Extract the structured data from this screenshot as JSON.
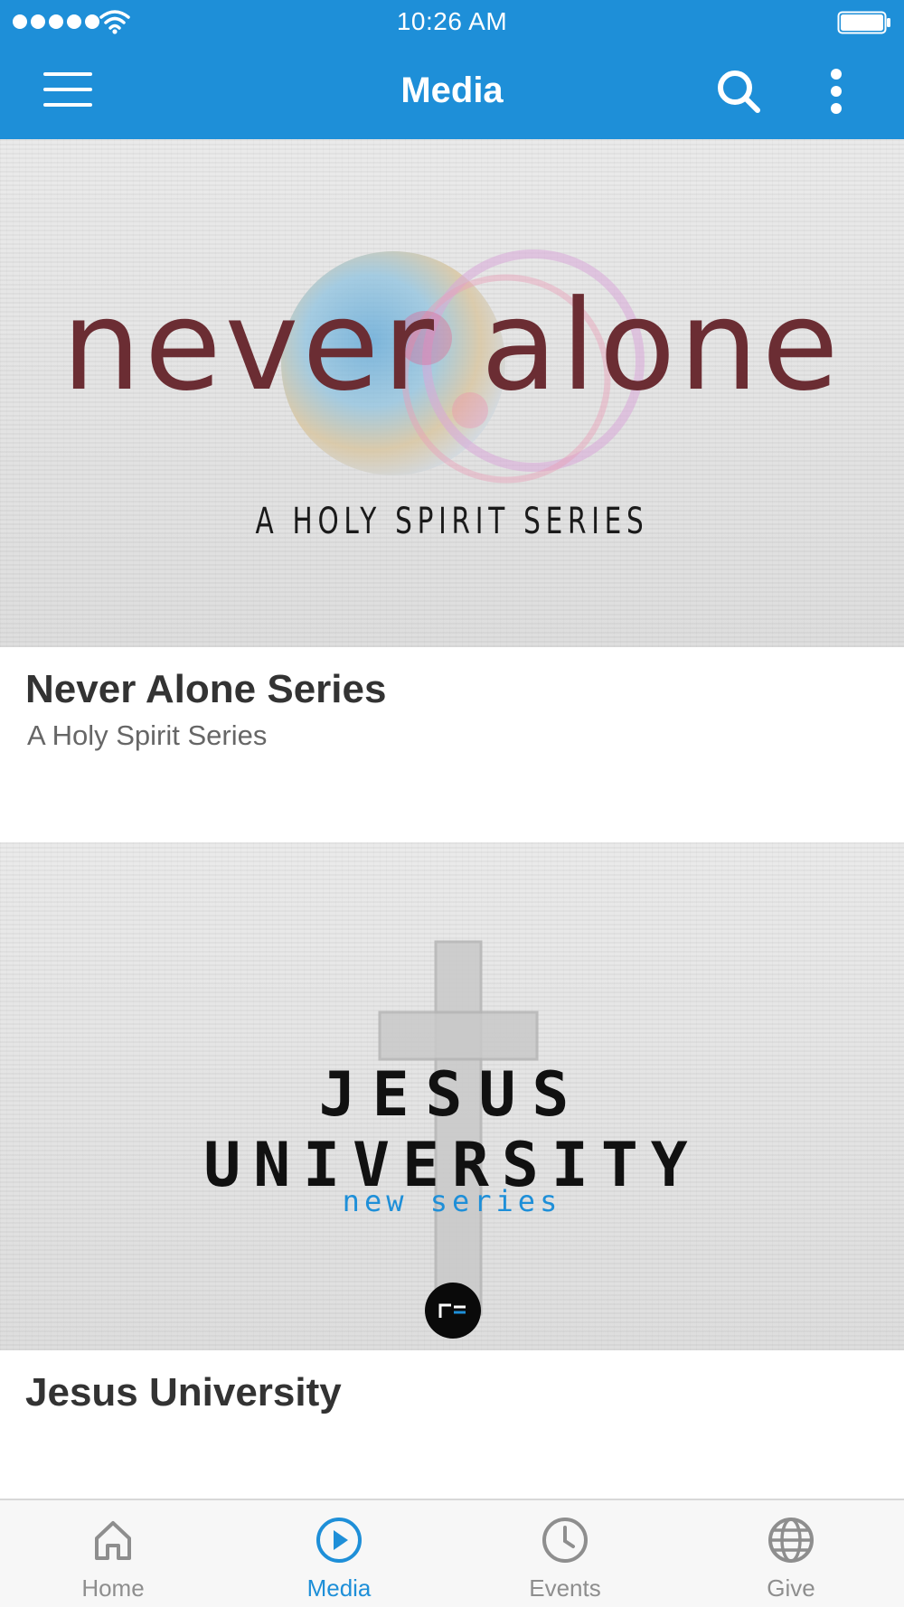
{
  "status_bar": {
    "time": "10:26 AM",
    "signal_icon": "signal-dots-icon",
    "wifi_icon": "wifi-icon",
    "battery_icon": "battery-icon"
  },
  "header": {
    "title": "Media",
    "menu_icon": "hamburger-menu-icon",
    "search_icon": "search-icon",
    "more_icon": "more-vertical-icon"
  },
  "colors": {
    "accent": "#1e8fd8",
    "inactive": "#8e8e8e",
    "never_alone_brand": "#6b2d33"
  },
  "media": [
    {
      "title": "Never Alone Series",
      "subtitle": "A Holy Spirit Series",
      "art": {
        "headline": "never alone",
        "tagline": "A HOLY SPIRIT SERIES"
      }
    },
    {
      "title": "Jesus University",
      "art": {
        "line1": "JESUS",
        "line2": "UNIVERSITY",
        "line3": "new series",
        "logo_icon": "church-logo-icon"
      }
    }
  ],
  "tabs": [
    {
      "label": "Home",
      "icon": "home-icon",
      "active": false
    },
    {
      "label": "Media",
      "icon": "play-circle-icon",
      "active": true
    },
    {
      "label": "Events",
      "icon": "clock-icon",
      "active": false
    },
    {
      "label": "Give",
      "icon": "globe-icon",
      "active": false
    }
  ]
}
